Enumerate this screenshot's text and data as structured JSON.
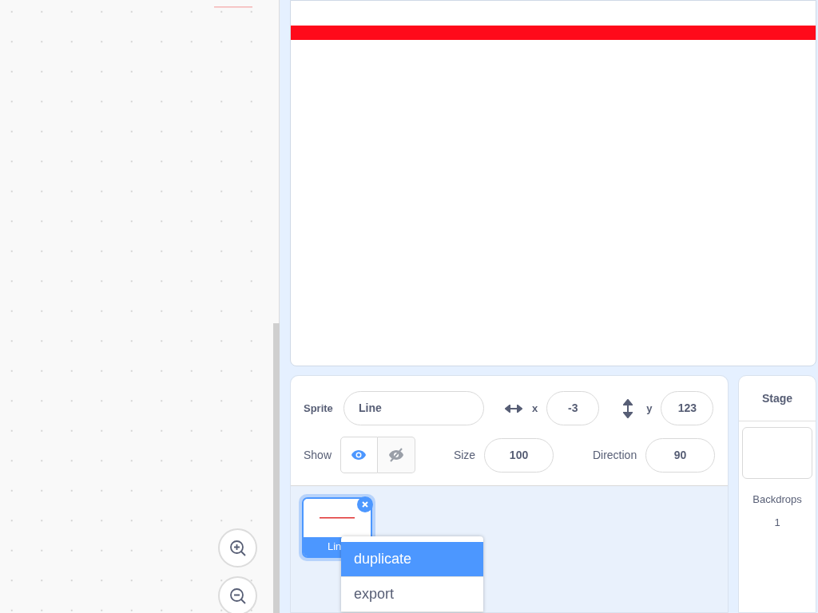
{
  "sprite_info": {
    "sprite_label": "Sprite",
    "sprite_name": "Line",
    "x_label": "x",
    "x_value": "-3",
    "y_label": "y",
    "y_value": "123",
    "show_label": "Show",
    "show_options": [
      {
        "kind": "visible",
        "selected": true
      },
      {
        "kind": "hidden",
        "selected": false
      }
    ],
    "size_label": "Size",
    "size_value": "100",
    "direction_label": "Direction",
    "direction_value": "90"
  },
  "sprites": [
    {
      "name": "Lin",
      "selected": true
    }
  ],
  "context_menu": [
    {
      "label": "duplicate",
      "selected": true
    },
    {
      "label": "export",
      "selected": false
    }
  ],
  "stage_pane": {
    "title": "Stage",
    "backdrops_label": "Backdrops",
    "backdrops_count": "1"
  }
}
